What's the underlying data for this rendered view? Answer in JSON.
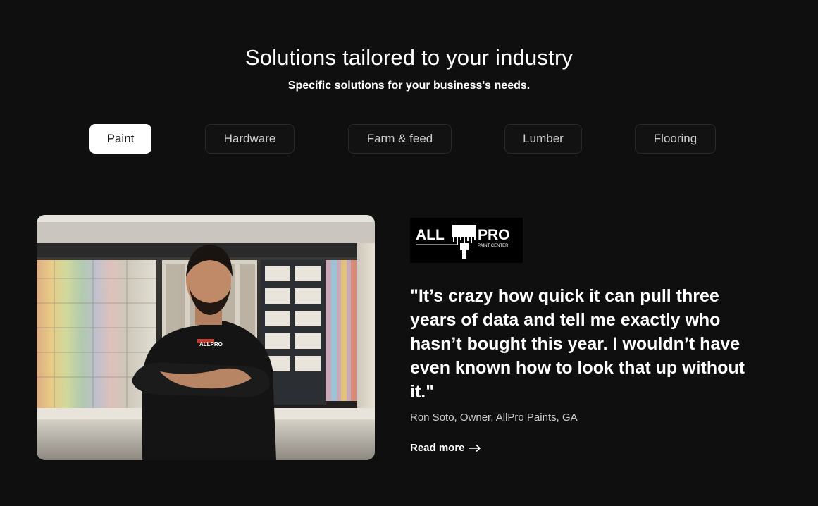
{
  "section": {
    "title": "Solutions tailored to your industry",
    "subtitle": "Specific solutions for your business's needs."
  },
  "tabs": [
    {
      "label": "Paint",
      "active": true
    },
    {
      "label": "Hardware",
      "active": false
    },
    {
      "label": "Farm & feed",
      "active": false
    },
    {
      "label": "Lumber",
      "active": false
    },
    {
      "label": "Flooring",
      "active": false
    }
  ],
  "testimonial": {
    "photo": {
      "shirt_logo": "ALLPRO"
    },
    "logo": {
      "brand_left": "ALL",
      "brand_right": "PRO",
      "tagline": "PAINT CENTER"
    },
    "quote": "\"It’s crazy how quick it can pull three years of data and tell me exactly who hasn’t bought this year. I wouldn’t have even known how to look that up without it.\"",
    "attribution": "Ron Soto, Owner, AllPro Paints, GA",
    "read_more": "Read more",
    "read_more_icon": "arrow-right-icon"
  },
  "colors": {
    "background": "#0f0f10",
    "active_tab_bg": "#ffffff",
    "tab_border": "#2a2a2c",
    "text": "#ffffff",
    "muted_text": "#cfcfd2"
  }
}
